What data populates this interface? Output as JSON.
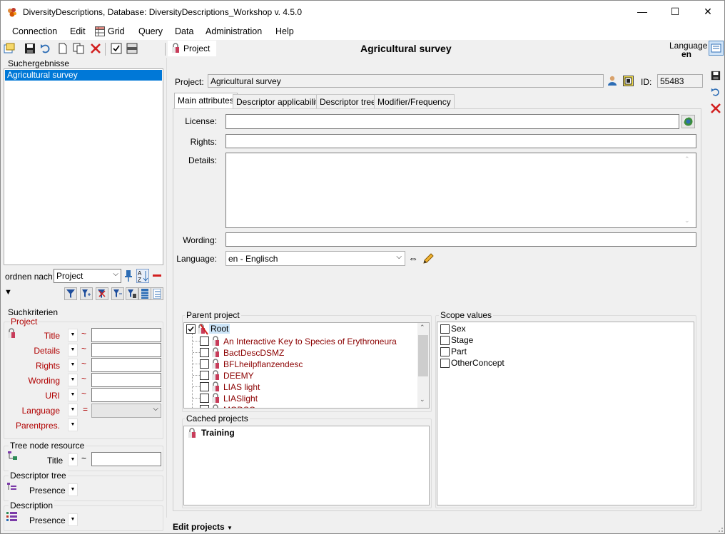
{
  "window": {
    "title": "DiversityDescriptions,  Database: DiversityDescriptions_Workshop    v. 4.5.0",
    "minimize": "—",
    "maximize": "☐",
    "close": "✕"
  },
  "menu": [
    {
      "label": "Connection"
    },
    {
      "label": "Edit"
    },
    {
      "label": "Grid"
    },
    {
      "label": "Query"
    },
    {
      "label": "Data"
    },
    {
      "label": "Administration"
    },
    {
      "label": "Help"
    }
  ],
  "toolbar": {
    "project_tab_label": "Project",
    "heading": "Agricultural survey",
    "language_label": "Language",
    "language_value": "en"
  },
  "left": {
    "results_title": "Suchergebnisse",
    "results": [
      "Agricultural survey"
    ],
    "order_label": "ordnen nach:",
    "order_value": "Project",
    "query_title": "Suchkriterien",
    "project_group": "Project",
    "fields": [
      {
        "label": "Title",
        "op": "~"
      },
      {
        "label": "Details",
        "op": "~"
      },
      {
        "label": "Rights",
        "op": "~"
      },
      {
        "label": "Wording",
        "op": "~"
      },
      {
        "label": "URI",
        "op": "~"
      },
      {
        "label": "Language",
        "op": "="
      },
      {
        "label": "Parentpres.",
        "op": ""
      }
    ],
    "tree_node_group": "Tree node resource",
    "tree_node_field": "Title",
    "tree_node_op": "~",
    "descriptor_tree_group": "Descriptor tree",
    "descriptor_tree_field": "Presence",
    "description_group": "Description",
    "description_field": "Presence"
  },
  "main": {
    "project_label": "Project:",
    "project_value": "Agricultural survey",
    "id_label": "ID:",
    "id_value": "55483",
    "tabs": [
      "Main attributes",
      "Descriptor applicability",
      "Descriptor tree",
      "Modifier/Frequency"
    ],
    "license_label": "License:",
    "license_value": "",
    "rights_label": "Rights:",
    "rights_value": "",
    "details_label": "Details:",
    "details_value": "",
    "wording_label": "Wording:",
    "wording_value": "",
    "language_label": "Language:",
    "language_value": "en - Englisch",
    "parent_project_title": "Parent project",
    "root_label": "Root",
    "parent_projects": [
      "An Interactive Key to Species of Erythroneura",
      "BactDescDSMZ",
      "BFLheilpflanzendesc",
      "DEEMY",
      "LIAS light",
      "LIASlight",
      "MODSO..."
    ],
    "cached_projects_title": "Cached projects",
    "cached_projects": [
      "Training"
    ],
    "scope_title": "Scope values",
    "scope_values": [
      "Sex",
      "Stage",
      "Part",
      "OtherConcept"
    ]
  },
  "statusbar": {
    "label": "Edit projects"
  },
  "colors": {
    "selection": "#0078d7",
    "red_label": "#b00000",
    "tree_red": "#8b0000"
  }
}
